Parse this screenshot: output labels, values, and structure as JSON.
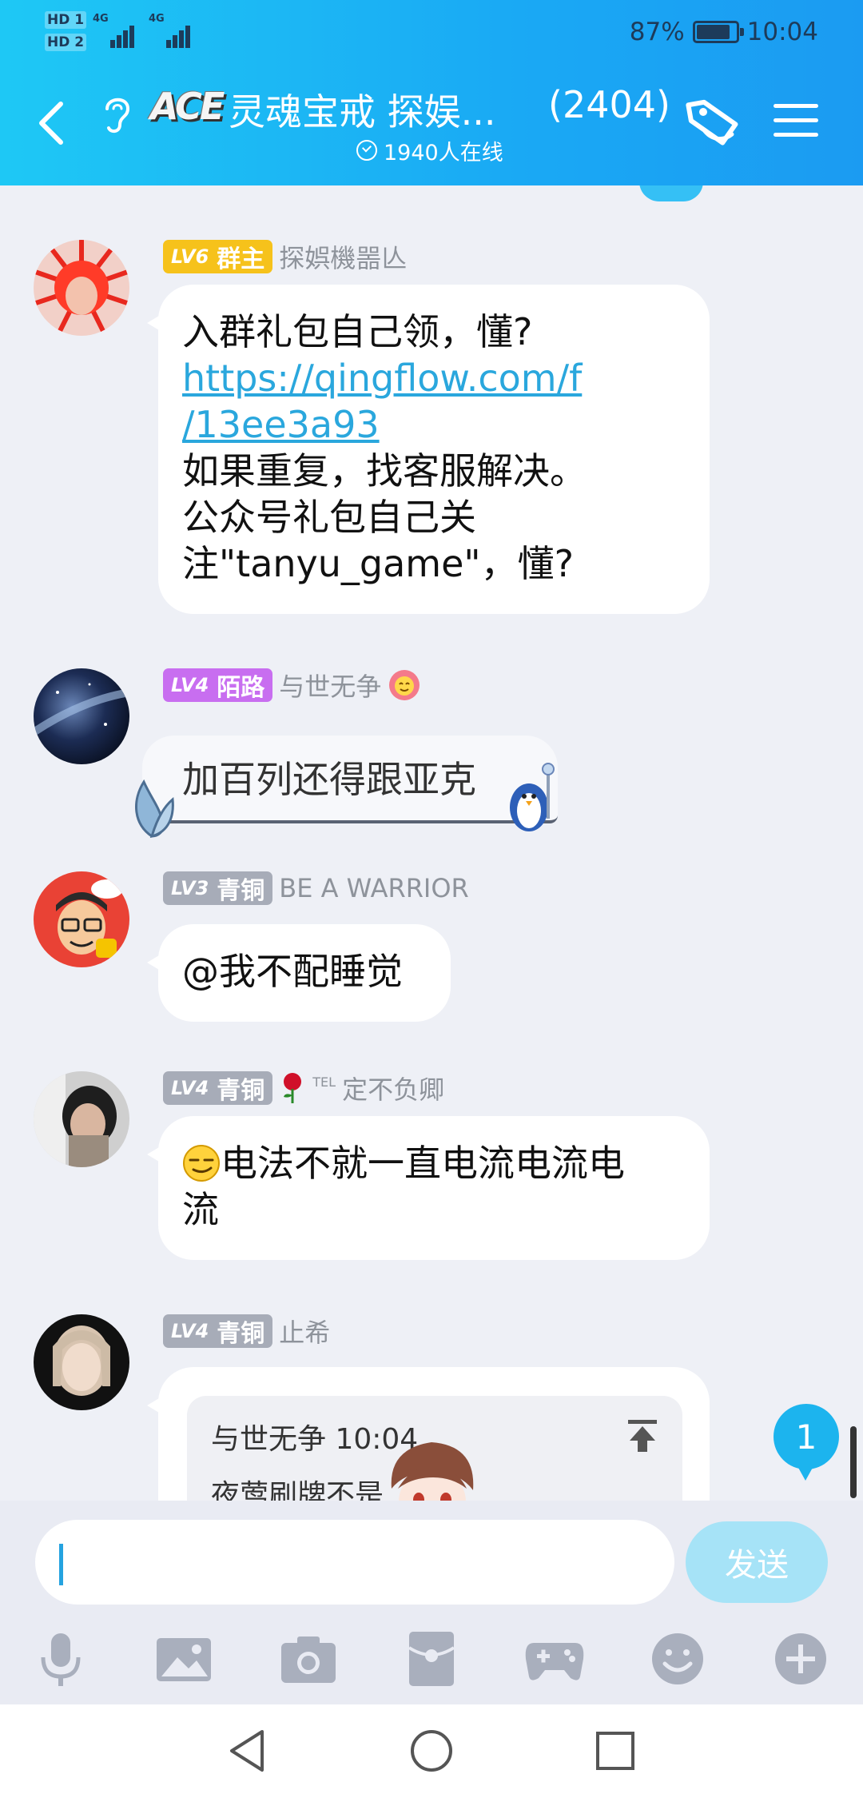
{
  "status_bar": {
    "hd1": "HD 1",
    "hd2": "HD 2",
    "net1": "4G",
    "net2": "4G",
    "battery": "87%",
    "time": "10:04"
  },
  "header": {
    "logo_text": "ACE",
    "group_name": "灵魂宝戒 探娱...",
    "member_count": "(2404)",
    "online_text": "1940人在线"
  },
  "messages": [
    {
      "level": "LV6",
      "title": "群主",
      "sender": "探娯機噐亾",
      "lines": [
        "入群礼包自己领，懂?"
      ],
      "link_lines": [
        "https://qingflow.com/f",
        "/13ee3a93"
      ],
      "after_lines": [
        "如果重复，找客服解决。",
        "公众号礼包自己关",
        "注\"tanyu_game\"，懂?"
      ]
    },
    {
      "level": "LV4",
      "title": "陌路",
      "sender": "与世无争",
      "text": "加百列还得跟亚克"
    },
    {
      "level": "LV3",
      "title": "青铜",
      "sender": "BE A WARRIOR",
      "text": "@我不配睡觉"
    },
    {
      "level": "LV4",
      "title": "青铜",
      "sender_prefix": "TEL",
      "sender": "定不负卿",
      "lines": [
        "电法不就一直电流电流电",
        "流"
      ]
    },
    {
      "level": "LV4",
      "title": "青铜",
      "sender": "止希",
      "quote_header": "与世无争 10:04",
      "quote_body": "夜莺刷牌不是"
    }
  ],
  "unread_count": "1",
  "input": {
    "value": "",
    "send_label": "发送"
  },
  "toolbar": [
    "microphone-icon",
    "image-icon",
    "camera-icon",
    "red-packet-icon",
    "gamepad-icon",
    "emoji-icon",
    "plus-icon"
  ],
  "colors": {
    "header_start": "#1ec8f5",
    "header_end": "#1b9bf2",
    "owner_badge": "#f6c21b",
    "purple_badge": "#c86ef0",
    "gray_badge": "#a7acb8",
    "link": "#2aa7dd",
    "send_button": "#a6e3f7"
  }
}
